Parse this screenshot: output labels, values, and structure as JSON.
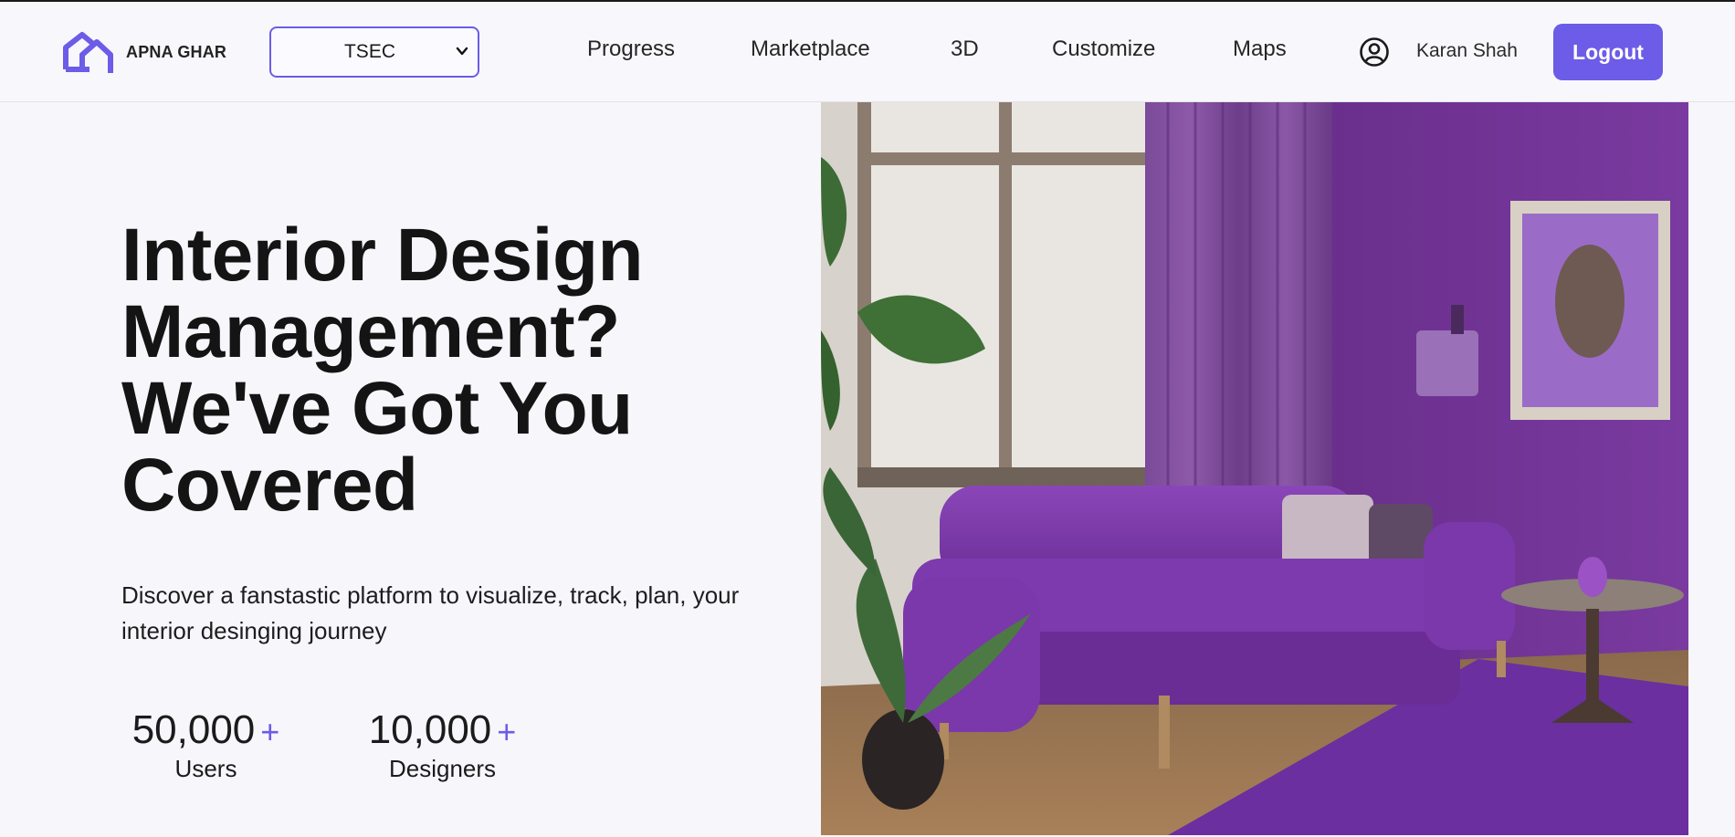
{
  "brand": {
    "name": "APNA GHAR",
    "logo": "house-logo-icon",
    "accent": "#6c5ce7"
  },
  "project_select": {
    "value": "TSEC"
  },
  "nav": [
    {
      "label": "Progress"
    },
    {
      "label": "Marketplace"
    },
    {
      "label": "3D"
    },
    {
      "label": "Customize"
    },
    {
      "label": "Maps"
    }
  ],
  "user": {
    "name": "Karan Shah",
    "icon": "user-circle-icon"
  },
  "logout": {
    "label": "Logout"
  },
  "hero": {
    "title_lines": [
      "Interior Design",
      "Management?",
      "We've Got You",
      "Covered"
    ],
    "subtitle": "Discover a fanstastic platform to visualize, track, plan, your interior desinging journey",
    "image_alt": "Purple living room with sofa"
  },
  "stats": [
    {
      "value": "50,000",
      "plus": "+",
      "label": "Users"
    },
    {
      "value": "10,000",
      "plus": "+",
      "label": "Designers"
    }
  ],
  "colors": {
    "primary": "#6c5ce7",
    "background": "#f7f6fb",
    "text": "#161616"
  }
}
